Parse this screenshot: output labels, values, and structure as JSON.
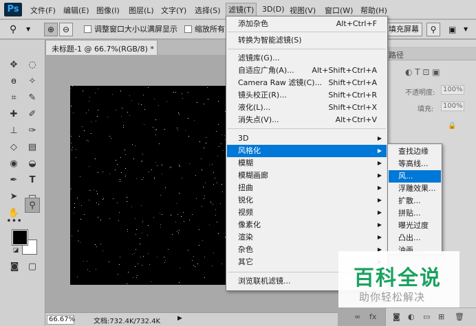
{
  "app": {
    "logo": "Ps"
  },
  "menubar": [
    {
      "label": "文件(F)"
    },
    {
      "label": "编辑(E)"
    },
    {
      "label": "图像(I)"
    },
    {
      "label": "图层(L)"
    },
    {
      "label": "文字(Y)"
    },
    {
      "label": "选择(S)"
    },
    {
      "label": "滤镜(T)"
    },
    {
      "label": "3D(D)"
    },
    {
      "label": "视图(V)"
    },
    {
      "label": "窗口(W)"
    },
    {
      "label": "帮助(H)"
    }
  ],
  "options": {
    "resize_window": "调整窗口大小以满屏显示",
    "zoom_all": "缩放所有",
    "fill_screen": "填充屏幕"
  },
  "document": {
    "tab_title": "未标题-1 @ 66.7%(RGB/8) *",
    "zoom": "66.67%",
    "doc_size": "文档:732.4K/732.4K"
  },
  "right_panel": {
    "tab": "路径",
    "opacity_label": "不透明度:",
    "opacity_value": "100%",
    "fill_label": "填充:",
    "fill_value": "100%"
  },
  "filter_menu": {
    "items": [
      {
        "label": "添加杂色",
        "shortcut": "Alt+Ctrl+F"
      },
      {
        "label": "转换为智能滤镜(S)"
      },
      {
        "label": "滤镜库(G)..."
      },
      {
        "label": "自适应广角(A)...",
        "shortcut": "Alt+Shift+Ctrl+A"
      },
      {
        "label": "Camera Raw 滤镜(C)...",
        "shortcut": "Shift+Ctrl+A"
      },
      {
        "label": "镜头校正(R)...",
        "shortcut": "Shift+Ctrl+R"
      },
      {
        "label": "液化(L)...",
        "shortcut": "Shift+Ctrl+X"
      },
      {
        "label": "消失点(V)...",
        "shortcut": "Alt+Ctrl+V"
      },
      {
        "label": "3D"
      },
      {
        "label": "风格化"
      },
      {
        "label": "模糊"
      },
      {
        "label": "模糊画廊"
      },
      {
        "label": "扭曲"
      },
      {
        "label": "锐化"
      },
      {
        "label": "视频"
      },
      {
        "label": "像素化"
      },
      {
        "label": "渲染"
      },
      {
        "label": "杂色"
      },
      {
        "label": "其它"
      },
      {
        "label": "浏览联机滤镜..."
      }
    ]
  },
  "stylize_submenu": {
    "items": [
      {
        "label": "查找边缘"
      },
      {
        "label": "等高线..."
      },
      {
        "label": "风..."
      },
      {
        "label": "浮雕效果..."
      },
      {
        "label": "扩散..."
      },
      {
        "label": "拼贴..."
      },
      {
        "label": "曝光过度"
      },
      {
        "label": "凸出..."
      },
      {
        "label": "油画..."
      }
    ]
  },
  "watermark": {
    "title": "百科全说",
    "subtitle": "助你轻松解决"
  }
}
